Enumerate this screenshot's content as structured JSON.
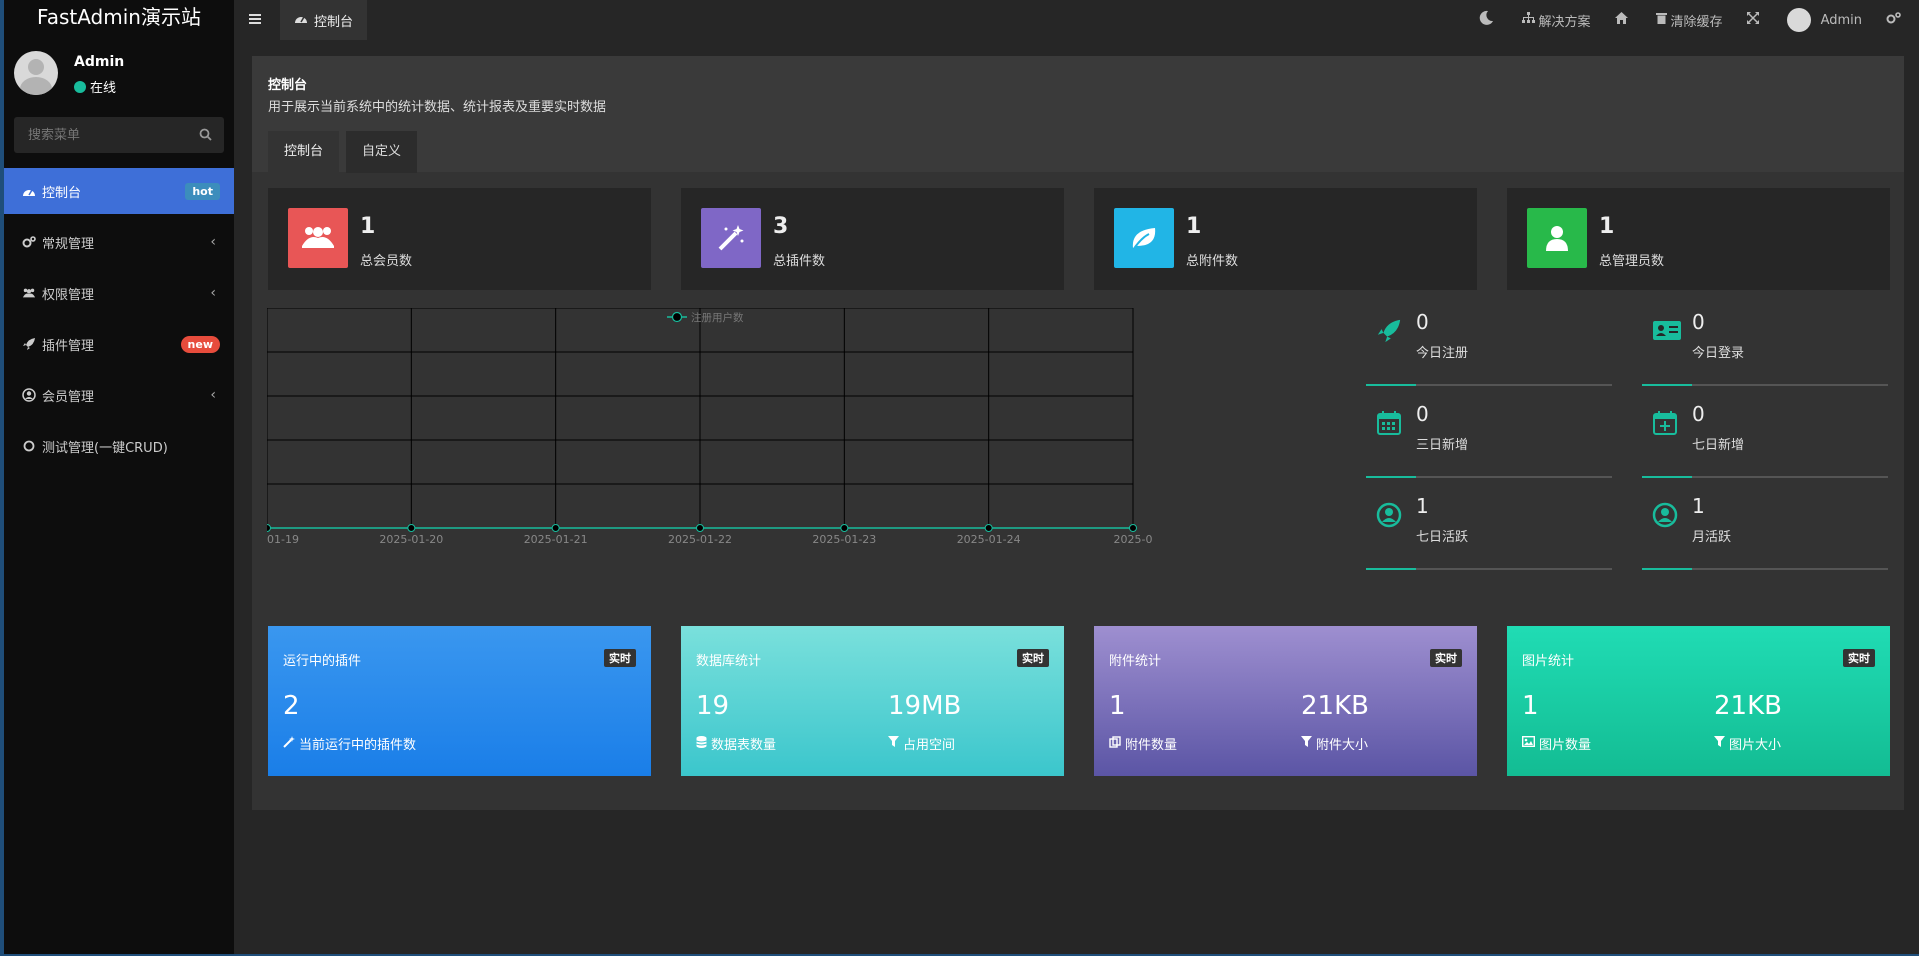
{
  "brand": "FastAdmin演示站",
  "user": {
    "name": "Admin",
    "status": "在线"
  },
  "search": {
    "placeholder": "搜索菜单"
  },
  "menu": [
    {
      "label": "控制台",
      "icon": "dashboard-icon",
      "badge": "hot",
      "active": true
    },
    {
      "label": "常规管理",
      "icon": "cogs-icon",
      "chevron": true
    },
    {
      "label": "权限管理",
      "icon": "group-icon",
      "chevron": true
    },
    {
      "label": "插件管理",
      "icon": "rocket-icon",
      "badge": "new"
    },
    {
      "label": "会员管理",
      "icon": "user-circle-icon",
      "chevron": true
    },
    {
      "label": "测试管理(一键CRUD)",
      "icon": "circle-icon"
    }
  ],
  "topbar": {
    "tab": "控制台",
    "solutions": "解决方案",
    "clear_cache": "清除缓存",
    "admin": "Admin"
  },
  "panel": {
    "title": "控制台",
    "description": "用于展示当前系统中的统计数据、统计报表及重要实时数据",
    "tabs": [
      "控制台",
      "自定义"
    ]
  },
  "info_boxes": [
    {
      "value": "1",
      "label": "总会员数",
      "color": "#e85656",
      "icon": "users-icon"
    },
    {
      "value": "3",
      "label": "总插件数",
      "color": "#7f67c6",
      "icon": "magic-icon"
    },
    {
      "value": "1",
      "label": "总附件数",
      "color": "#21b5e6",
      "icon": "leaf-icon"
    },
    {
      "value": "1",
      "label": "总管理员数",
      "color": "#28b94a",
      "icon": "user-icon"
    }
  ],
  "stats": [
    {
      "value": "0",
      "label": "今日注册",
      "icon": "rocket-icon"
    },
    {
      "value": "0",
      "label": "今日登录",
      "icon": "vcard-icon"
    },
    {
      "value": "0",
      "label": "三日新增",
      "icon": "calendar-icon"
    },
    {
      "value": "0",
      "label": "七日新增",
      "icon": "calendar-plus-icon"
    },
    {
      "value": "1",
      "label": "七日活跃",
      "icon": "user-circle-icon"
    },
    {
      "value": "1",
      "label": "月活跃",
      "icon": "user-circle-icon"
    }
  ],
  "chart_data": {
    "type": "line",
    "title": "",
    "legend": [
      "注册用户数"
    ],
    "categories": [
      "01-19",
      "2025-01-20",
      "2025-01-21",
      "2025-01-22",
      "2025-01-23",
      "2025-01-24",
      "2025-0"
    ],
    "series": [
      {
        "name": "注册用户数",
        "values": [
          0,
          0,
          0,
          0,
          0,
          0,
          0
        ]
      }
    ],
    "xlabel": "",
    "ylabel": "",
    "grid": true,
    "legend_position": "top-center",
    "line_color": "#18bc9c"
  },
  "cards": [
    {
      "title": "运行中的插件",
      "badge": "实时",
      "gradient": [
        "#3a97ef",
        "#1a7ee8"
      ],
      "items": [
        {
          "value": "2",
          "label": "当前运行中的插件数",
          "icon": "magic-icon"
        }
      ]
    },
    {
      "title": "数据库统计",
      "badge": "实时",
      "gradient": [
        "#7ae0dc",
        "#3bc6cc"
      ],
      "items": [
        {
          "value": "19",
          "label": "数据表数量",
          "icon": "database-icon"
        },
        {
          "value": "19MB",
          "label": "占用空间",
          "icon": "filter-icon"
        }
      ]
    },
    {
      "title": "附件统计",
      "badge": "实时",
      "gradient": [
        "#9e8fd0",
        "#5b55a5"
      ],
      "items": [
        {
          "value": "1",
          "label": "附件数量",
          "icon": "files-icon"
        },
        {
          "value": "21KB",
          "label": "附件大小",
          "icon": "filter-icon"
        }
      ]
    },
    {
      "title": "图片统计",
      "badge": "实时",
      "gradient": [
        "#20dcb4",
        "#13bc93"
      ],
      "items": [
        {
          "value": "1",
          "label": "图片数量",
          "icon": "image-icon"
        },
        {
          "value": "21KB",
          "label": "图片大小",
          "icon": "filter-icon"
        }
      ]
    }
  ]
}
